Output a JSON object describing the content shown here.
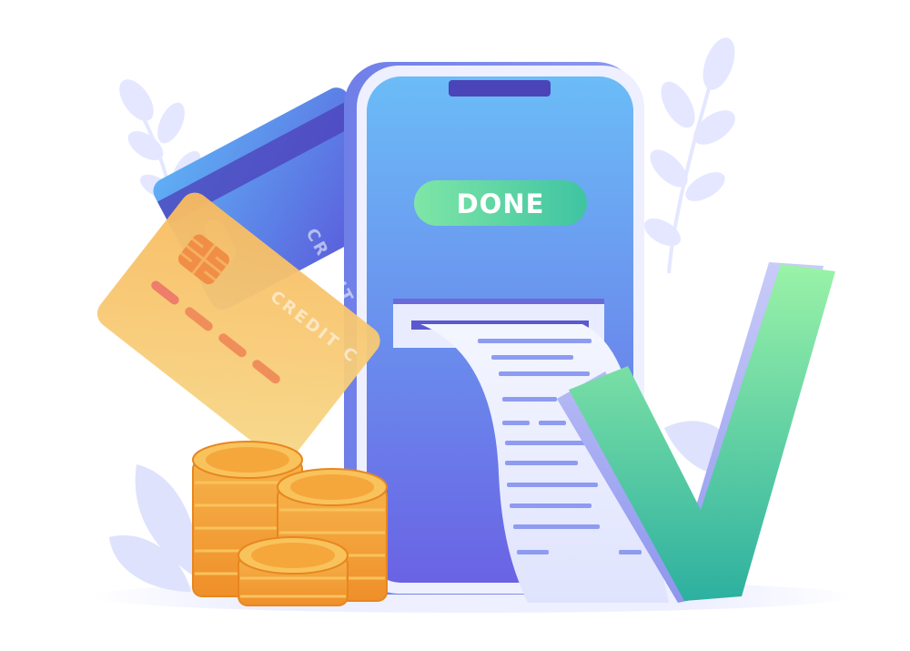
{
  "phone": {
    "status_label": "DONE"
  },
  "cards": [
    {
      "label": "CREDIT"
    },
    {
      "label": "CREDIT C"
    }
  ],
  "colors": {
    "phone_screen_top": "#6bbcf7",
    "phone_screen_bottom": "#6a67e6",
    "phone_frame": "#e8ebff",
    "done_pill_left": "#7be0a8",
    "done_pill_right": "#3fc7a0",
    "done_text": "#ffffff",
    "blue_card": "#5b79e8",
    "gold_card": "#f7c26a",
    "coin": "#f5a33b",
    "check_top": "#8ff2a8",
    "check_bottom": "#2fb3a0",
    "receipt": "#eef1ff",
    "receipt_lines": "#8f9cf2",
    "leaves": "#e3e6ff"
  },
  "icons": [
    "leaf-icon",
    "credit-card-icon",
    "card-chip-icon",
    "coin-stack-icon",
    "check-mark-icon",
    "receipt-icon",
    "smartphone-icon"
  ]
}
